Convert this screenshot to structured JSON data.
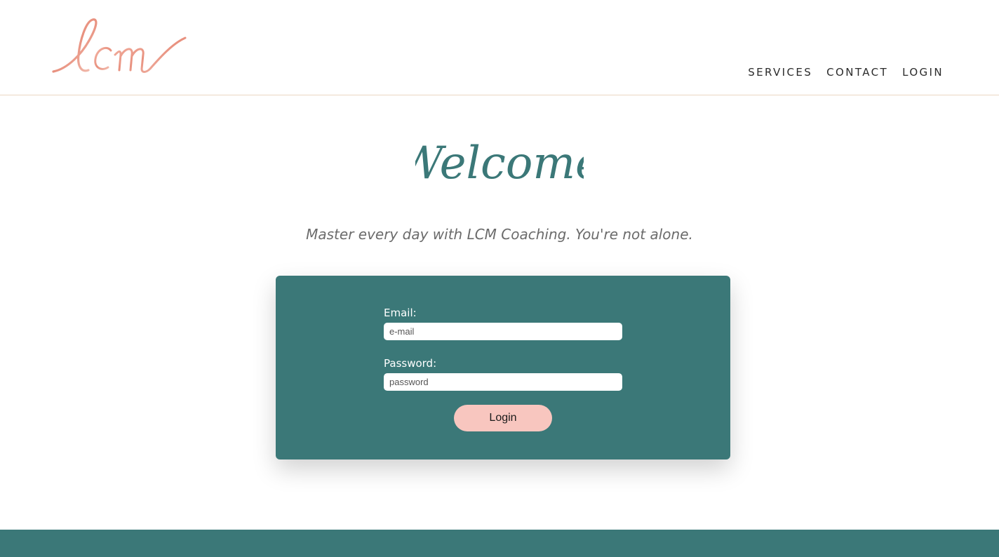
{
  "header": {
    "logo_text": "lcm",
    "nav": [
      {
        "label": "SERVICES"
      },
      {
        "label": "CONTACT"
      },
      {
        "label": "LOGIN"
      }
    ]
  },
  "hero": {
    "welcome": "Welcome",
    "tagline": "Master every day with LCM Coaching. You're not alone."
  },
  "login_form": {
    "email_label": "Email:",
    "email_placeholder": "e-mail",
    "email_value": "",
    "password_label": "Password:",
    "password_placeholder": "password",
    "password_value": "",
    "submit_label": "Login"
  },
  "colors": {
    "teal": "#3b7878",
    "blush": "#f8c6bf",
    "logo_pink": "#eaa08f",
    "header_border": "#ead7c2"
  }
}
